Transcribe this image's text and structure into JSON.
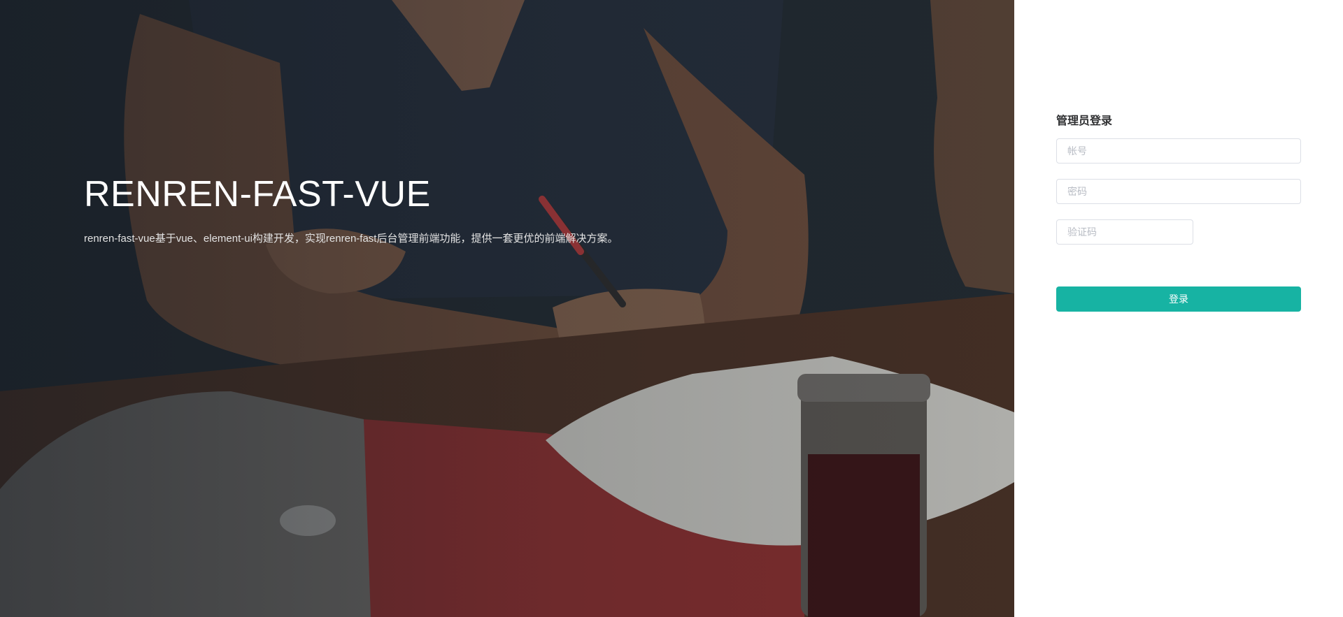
{
  "hero": {
    "title": "RENREN-FAST-VUE",
    "description": "renren-fast-vue基于vue、element-ui构建开发，实现renren-fast后台管理前端功能，提供一套更优的前端解决方案。"
  },
  "login": {
    "heading": "管理员登录",
    "username_placeholder": "帐号",
    "username_value": "",
    "password_placeholder": "密码",
    "password_value": "",
    "captcha_placeholder": "验证码",
    "captcha_value": "",
    "submit_label": "登录"
  },
  "colors": {
    "accent": "#17b3a3",
    "hero_overlay": "#1f262c",
    "panel_bg": "#ffffff"
  }
}
